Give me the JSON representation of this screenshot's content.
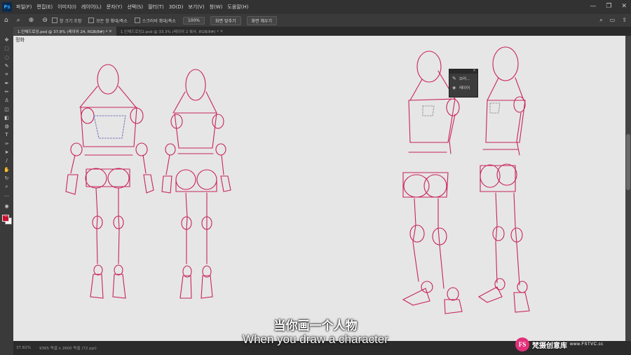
{
  "app": {
    "logo_text": "Ps"
  },
  "menu": [
    "파일(F)",
    "편집(E)",
    "이미지(I)",
    "레이어(L)",
    "문자(Y)",
    "선택(S)",
    "필터(T)",
    "3D(D)",
    "보기(V)",
    "창(W)",
    "도움말(H)"
  ],
  "window_controls": {
    "minimize": "—",
    "restore": "❐",
    "close": "✕"
  },
  "options_bar": {
    "check_resize": "창 크기 조정",
    "check_zoom_all": "모든 창 확대/축소",
    "check_scrubby": "스크러비 확대/축소",
    "zoom_value": "100%",
    "fit_screen": "화면 맞추기",
    "fill_screen": "화면 채우기"
  },
  "tabs": [
    {
      "label": "1.인체드로잉.psd @ 37.8% (레이어 24, RGB/8#) *",
      "close": "×"
    },
    {
      "label": "1.인체드로잉2.psd @ 33.3% (레이어 2 복사, RGB/8#) *",
      "close": "×"
    }
  ],
  "canvas_label": "정화",
  "status": {
    "zoom": "37.82%",
    "doc_size": "9365 픽셀 x 2600 픽셀 (72 ppi)"
  },
  "float_panel": {
    "items": [
      {
        "label": "브러...",
        "icon": "brush-icon"
      },
      {
        "label": "레이어",
        "icon": "layers-icon"
      }
    ]
  },
  "subtitle": {
    "zh": "当你画一个人物",
    "en": "When you draw a character"
  },
  "watermark": {
    "badge": "FS",
    "name": "梵摄创意库",
    "url": "www.FSTVC.cc"
  },
  "colors": {
    "sketch": "#c8245a",
    "canvas": "#e6e6e6",
    "foreground": "#c8102e",
    "background": "#ffffff"
  }
}
